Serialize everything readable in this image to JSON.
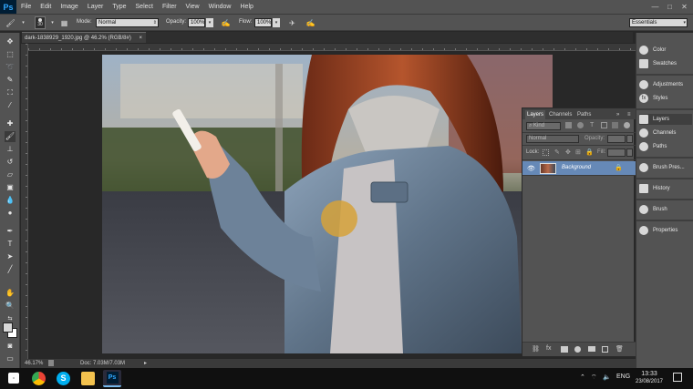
{
  "app": {
    "logo": "Ps",
    "menu": [
      "File",
      "Edit",
      "Image",
      "Layer",
      "Type",
      "Select",
      "Filter",
      "View",
      "Window",
      "Help"
    ],
    "window_controls": [
      "—",
      "□",
      "✕"
    ]
  },
  "options_bar": {
    "brush_size": "30",
    "mode_label": "Mode:",
    "mode_value": "Normal",
    "opacity_label": "Opacity:",
    "opacity_value": "100%",
    "flow_label": "Flow:",
    "flow_value": "100%",
    "workspace": "Essentials"
  },
  "document": {
    "tab_title": "dark-1838929_1920.jpg @ 46.2% (RGB/8#)",
    "tab_close": "×"
  },
  "status_bar": {
    "zoom": "46.17%",
    "doc_info": "Doc: 7.03M/7.03M",
    "arrow": "▸"
  },
  "layers_panel": {
    "tabs": [
      "Layers",
      "Channels",
      "Paths"
    ],
    "filter_kind": "Kind",
    "blend_mode": "Normal",
    "opacity_label": "Opacity:",
    "lock_label": "Lock:",
    "fill_label": "Fill:",
    "layer_name": "Background"
  },
  "dock": {
    "items": [
      "Color",
      "Swatches",
      "Adjustments",
      "Styles",
      "Layers",
      "Channels",
      "Paths",
      "Brush Pres...",
      "History",
      "Brush",
      "Properties"
    ]
  },
  "taskbar": {
    "lang": "ENG",
    "time": "13:33",
    "date": "23/08/2017"
  },
  "colors": {
    "chrome": "#535353",
    "canvas_bg": "#282828",
    "selected_layer": "#6689b7",
    "ps_blue": "#31a8ff"
  }
}
